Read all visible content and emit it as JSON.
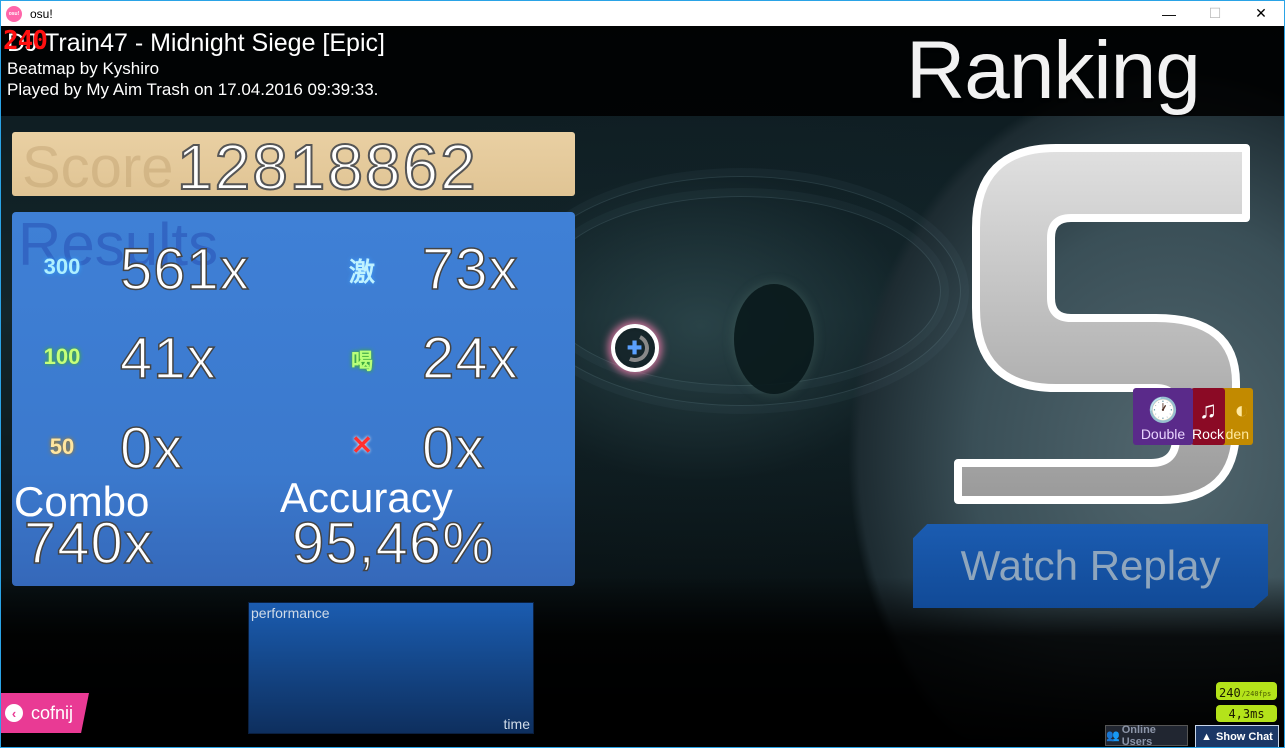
{
  "window": {
    "app_icon_text": "osu!",
    "title": "osu!",
    "minimize_glyph": "—",
    "maximize_glyph": "☐",
    "close_glyph": "✕"
  },
  "header": {
    "fps_overlay": "240",
    "song_title": "DJ Train47 - Midnight Siege [Epic]",
    "mapper_line": "Beatmap by Kyshiro",
    "played_line": "Played by My Aim Trash on 17.04.2016 09:39:33.",
    "ranking_title": "Ranking"
  },
  "score": {
    "label": "Score",
    "value": "12818862"
  },
  "results": {
    "label": "Results",
    "hits": [
      {
        "label": "300",
        "count": "561x",
        "color_class": "c300"
      },
      {
        "label": "激",
        "count": "73x",
        "color_class": "cgeki"
      },
      {
        "label": "100",
        "count": "41x",
        "color_class": "c100"
      },
      {
        "label": "喝",
        "count": "24x",
        "color_class": "ckatu"
      },
      {
        "label": "50",
        "count": "0x",
        "color_class": "c50"
      },
      {
        "label": "✕",
        "count": "0x",
        "color_class": "cmiss"
      }
    ],
    "combo_label": "Combo",
    "combo_value": "740x",
    "accuracy_label": "Accuracy",
    "accuracy_value": "95,46%"
  },
  "performance_graph": {
    "y_label": "performance",
    "x_label": "time"
  },
  "rank": {
    "grade": "S",
    "colors": {
      "fill": "#bdbdbd",
      "outline": "#ffffff"
    }
  },
  "mods": [
    {
      "name": "Double",
      "icon": "clock-icon",
      "glyph": "🕐",
      "color": "#5a2a8a"
    },
    {
      "name": "Rock",
      "icon": "music-notes-icon",
      "glyph": "♫",
      "color": "#8b0a25"
    },
    {
      "name": "den",
      "icon": "hidden-icon",
      "glyph": "◐",
      "color": "#c28a00"
    }
  ],
  "buttons": {
    "watch_replay": "Watch Replay",
    "back": "cofnij",
    "online_users": "Online Users",
    "show_chat": "Show Chat"
  },
  "stats": {
    "fps": "240",
    "fps_max": "/240fps",
    "frame_time": "4,3ms"
  },
  "colors": {
    "score_panel": "#e5c99a",
    "results_panel": "#3f80d6",
    "back_button": "#e93a94",
    "fps_badge": "#b4e31a",
    "window_border": "#2aa3e6"
  }
}
